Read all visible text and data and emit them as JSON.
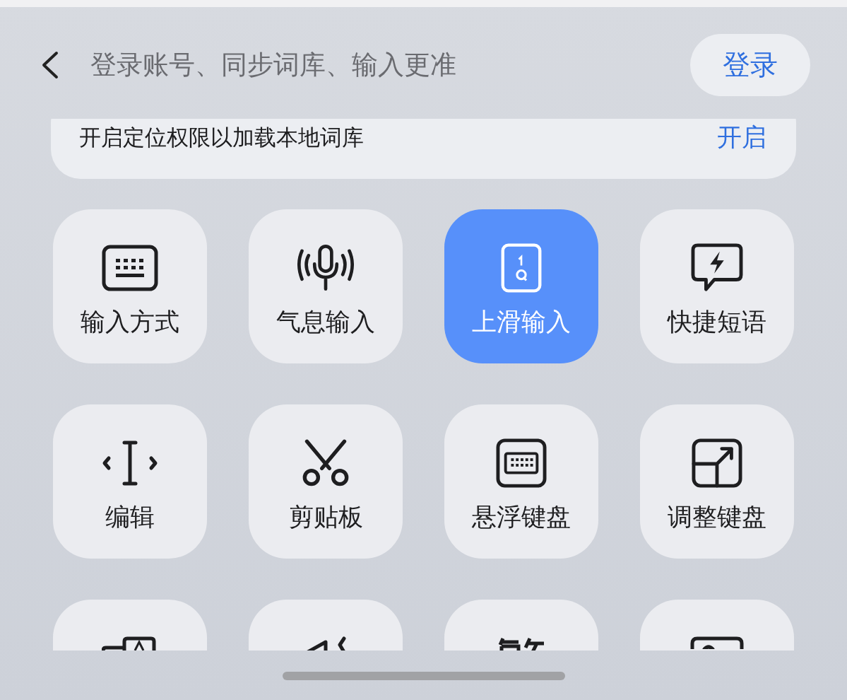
{
  "header": {
    "title": "登录账号、同步词库、输入更准",
    "login_button": "登录"
  },
  "banner": {
    "text": "开启定位权限以加载本地词库",
    "action": "开启"
  },
  "tiles": [
    {
      "label": "输入方式",
      "selected": false
    },
    {
      "label": "气息输入",
      "selected": false
    },
    {
      "label": "上滑输入",
      "selected": true
    },
    {
      "label": "快捷短语",
      "selected": false
    },
    {
      "label": "编辑",
      "selected": false
    },
    {
      "label": "剪贴板",
      "selected": false
    },
    {
      "label": "悬浮键盘",
      "selected": false
    },
    {
      "label": "调整键盘",
      "selected": false
    },
    {
      "selected": false
    },
    {
      "selected": false
    },
    {
      "selected": false
    },
    {
      "selected": false
    }
  ]
}
